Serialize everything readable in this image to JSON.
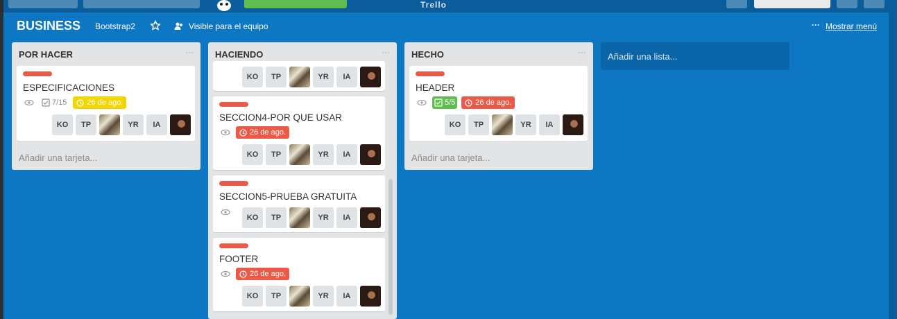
{
  "topbar": {
    "logo_text": "Trello"
  },
  "board": {
    "title": "BUSINESS",
    "team": "Bootstrap2",
    "visibility": "Visible para el equipo",
    "menu_dots": "···",
    "menu_label": "Mostrar menú"
  },
  "lists": [
    {
      "title": "POR HACER",
      "menu": "···",
      "add_card": "Añadir una tarjeta...",
      "cards": [
        {
          "title": "ESPECIFICACIONES",
          "checklist": "7/15",
          "due": "26 de ago.",
          "due_status": "soon",
          "members": [
            "KO",
            "TP",
            "",
            "YR",
            "IA",
            ""
          ]
        }
      ]
    },
    {
      "title": "HACIENDO",
      "menu": "···",
      "cards": [
        {
          "title": "",
          "members": [
            "KO",
            "TP",
            "",
            "YR",
            "IA",
            ""
          ]
        },
        {
          "title": "SECCION4-POR QUE USAR",
          "due": "26 de ago.",
          "due_status": "overdue",
          "members": [
            "KO",
            "TP",
            "",
            "YR",
            "IA",
            ""
          ]
        },
        {
          "title": "SECCION5-PRUEBA GRATUITA",
          "members": [
            "KO",
            "TP",
            "",
            "YR",
            "IA",
            ""
          ]
        },
        {
          "title": "FOOTER",
          "due": "26 de ago.",
          "due_status": "overdue",
          "members": [
            "KO",
            "TP",
            "",
            "YR",
            "IA",
            ""
          ]
        }
      ]
    },
    {
      "title": "HECHO",
      "menu": "···",
      "add_card": "Añadir una tarjeta...",
      "cards": [
        {
          "title": "HEADER",
          "checklist": "5/5",
          "due": "26 de ago.",
          "due_status": "overdue",
          "members": [
            "KO",
            "TP",
            "",
            "YR",
            "IA",
            ""
          ]
        }
      ]
    }
  ],
  "add_list": "Añadir una lista...",
  "colors": {
    "board_bg": "#0d77c3",
    "label_red": "#eb5a46",
    "due_soon": "#f2d600",
    "check_done": "#61bd4f"
  }
}
